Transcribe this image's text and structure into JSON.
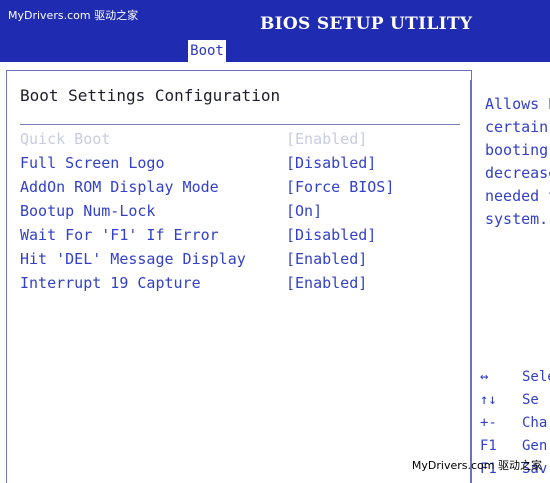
{
  "watermark": "MyDrivers.com 驱动之家",
  "header": {
    "title": "BIOS SETUP UTILITY",
    "active_tab": "Boot"
  },
  "section": {
    "title": "Boot Settings Configuration"
  },
  "settings": [
    {
      "label": "Quick Boot",
      "value": "[Enabled]",
      "state": "disabled"
    },
    {
      "label": "Full Screen Logo",
      "value": "[Disabled]",
      "state": "normal"
    },
    {
      "label": "AddOn ROM Display Mode",
      "value": "[Force BIOS]",
      "state": "normal"
    },
    {
      "label": "Bootup Num-Lock",
      "value": "[On]",
      "state": "normal"
    },
    {
      "label": "Wait For 'F1' If Error",
      "value": "[Disabled]",
      "state": "normal"
    },
    {
      "label": "Hit 'DEL' Message Display",
      "value": "[Enabled]",
      "state": "normal"
    },
    {
      "label": "Interrupt 19 Capture",
      "value": "[Enabled]",
      "state": "normal"
    }
  ],
  "help": {
    "lines": [
      "Allows B",
      "certain",
      "booting.",
      "decrease",
      "needed t",
      "system."
    ]
  },
  "keys": [
    {
      "key": "↔",
      "desc": "Sele"
    },
    {
      "key": "↑↓",
      "desc": "Se"
    },
    {
      "key": "+-",
      "desc": "Cha"
    },
    {
      "key": "F1",
      "desc": "Gen"
    },
    {
      "key": "F1",
      "desc": "Sav"
    }
  ],
  "colors": {
    "header_bg": "#1f2bb0",
    "text": "#3340c8",
    "disabled": "#c9ccdf"
  }
}
